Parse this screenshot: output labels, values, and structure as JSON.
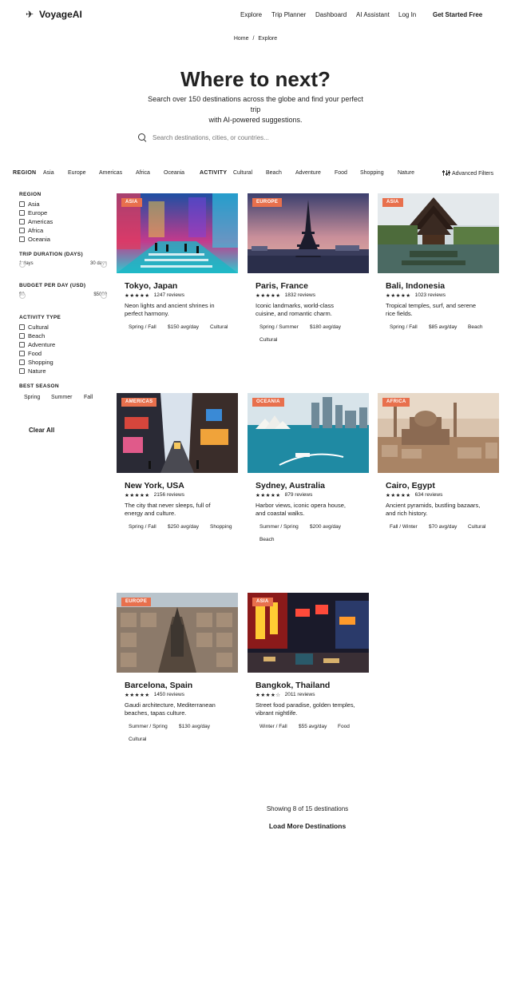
{
  "brand": {
    "name": "VoyageAI",
    "icon": "airplane-icon"
  },
  "nav": {
    "explore": "Explore",
    "planner": "Trip Planner",
    "dashboard": "Dashboard",
    "assistant": "AI Assistant",
    "login": "Log In",
    "cta": "Get Started Free"
  },
  "breadcrumb": {
    "home": "Home",
    "sep": "/",
    "current": "Explore"
  },
  "hero": {
    "title": "Where to next?",
    "subtitle_1": "Search over 150 destinations across the globe and find your perfect trip",
    "subtitle_2": "with AI-powered suggestions."
  },
  "search": {
    "placeholder": "Search destinations, cities, or countries..."
  },
  "filterbar": {
    "region_label": "REGION",
    "regions": [
      "Asia",
      "Europe",
      "Americas",
      "Africa",
      "Oceania"
    ],
    "activity_label": "ACTIVITY",
    "activities": [
      "Cultural",
      "Beach",
      "Adventure",
      "Food",
      "Shopping",
      "Nature"
    ],
    "advanced": "Advanced Filters"
  },
  "sidebar": {
    "region_heading": "REGION",
    "regions": [
      "Asia",
      "Europe",
      "Americas",
      "Africa",
      "Oceania"
    ],
    "duration_heading": "TRIP DURATION (DAYS)",
    "duration_min": "1 days",
    "duration_max": "30 days",
    "budget_heading": "BUDGET PER DAY (USD)",
    "budget_min": "$0",
    "budget_max": "$5000",
    "activity_heading": "ACTIVITY TYPE",
    "activities": [
      "Cultural",
      "Beach",
      "Adventure",
      "Food",
      "Shopping",
      "Nature"
    ],
    "season_heading": "BEST SEASON",
    "seasons": [
      "Spring",
      "Summer",
      "Fall"
    ],
    "clear": "Clear All"
  },
  "cards": [
    {
      "region": "ASIA",
      "title": "Tokyo, Japan",
      "stars": "★★★★★",
      "reviews": "1247 reviews",
      "desc": "Neon lights and ancient shrines in perfect harmony.",
      "season": "Spring / Fall",
      "price": "$150 avg/day",
      "tag": "Cultural"
    },
    {
      "region": "EUROPE",
      "title": "Paris, France",
      "stars": "★★★★★",
      "reviews": "1832 reviews",
      "desc": "Iconic landmarks, world-class cuisine, and romantic charm.",
      "season": "Spring / Summer",
      "price": "$180 avg/day",
      "tag": "Cultural"
    },
    {
      "region": "ASIA",
      "title": "Bali, Indonesia",
      "stars": "★★★★★",
      "reviews": "1023 reviews",
      "desc": "Tropical temples, surf, and serene rice fields.",
      "season": "Spring / Fall",
      "price": "$85 avg/day",
      "tag": "Beach"
    },
    {
      "region": "AMERICAS",
      "title": "New York, USA",
      "stars": "★★★★★",
      "reviews": "2156 reviews",
      "desc": "The city that never sleeps, full of energy and culture.",
      "season": "Spring / Fall",
      "price": "$250 avg/day",
      "tag": "Shopping"
    },
    {
      "region": "OCEANIA",
      "title": "Sydney, Australia",
      "stars": "★★★★★",
      "reviews": "879 reviews",
      "desc": "Harbor views, iconic opera house, and coastal walks.",
      "season": "Summer / Spring",
      "price": "$200 avg/day",
      "tag": "Beach"
    },
    {
      "region": "AFRICA",
      "title": "Cairo, Egypt",
      "stars": "★★★★★",
      "reviews": "634 reviews",
      "desc": "Ancient pyramids, bustling bazaars, and rich history.",
      "season": "Fall / Winter",
      "price": "$70 avg/day",
      "tag": "Cultural"
    },
    {
      "region": "EUROPE",
      "title": "Barcelona, Spain",
      "stars": "★★★★★",
      "reviews": "1450 reviews",
      "desc": "Gaudi architecture, Mediterranean beaches, tapas culture.",
      "season": "Summer / Spring",
      "price": "$130 avg/day",
      "tag": "Cultural"
    },
    {
      "region": "ASIA",
      "title": "Bangkok, Thailand",
      "stars": "★★★★☆",
      "reviews": "2011 reviews",
      "desc": "Street food paradise, golden temples, vibrant nightlife.",
      "season": "Winter / Fall",
      "price": "$55 avg/day",
      "tag": "Food"
    }
  ],
  "results": {
    "showing": "Showing 8 of 15 destinations",
    "load_more": "Load More Destinations"
  },
  "colors": {
    "badge": "#e8704d",
    "text": "#1a1a1a"
  }
}
